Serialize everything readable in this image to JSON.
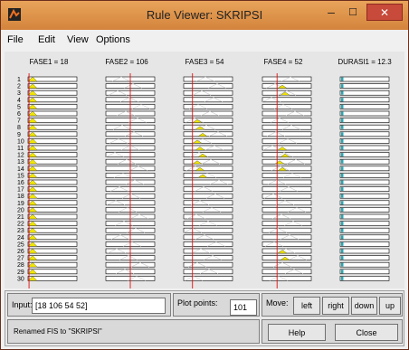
{
  "window": {
    "title": "Rule Viewer: SKRIPSI"
  },
  "menu": [
    "File",
    "Edit",
    "View",
    "Options"
  ],
  "columns": [
    {
      "label": "FASE1 = 18",
      "value_frac": 0.02
    },
    {
      "label": "FASE2 = 106",
      "value_frac": 0.5
    },
    {
      "label": "FASE3 = 54",
      "value_frac": 0.18
    },
    {
      "label": "FASE4 = 52",
      "value_frac": 0.3
    },
    {
      "label": "DURASI1 = 12.3",
      "value_frac": 0.0
    }
  ],
  "rules": [
    "1",
    "2",
    "3",
    "4",
    "5",
    "6",
    "7",
    "8",
    "9",
    "10",
    "11",
    "12",
    "13",
    "14",
    "15",
    "16",
    "17",
    "18",
    "19",
    "20",
    "21",
    "22",
    "23",
    "24",
    "25",
    "26",
    "27",
    "28",
    "29",
    "30"
  ],
  "input": {
    "label": "Input:",
    "value": "[18 106 54 52]"
  },
  "plot_points": {
    "label": "Plot points:",
    "value": "101"
  },
  "move": {
    "label": "Move:",
    "left": "left",
    "right": "right",
    "down": "down",
    "up": "up"
  },
  "status": "Renamed FIS to \"SKRIPSI\"",
  "buttons": {
    "help": "Help",
    "close": "Close"
  },
  "colors": {
    "fill": "#f2e600",
    "line": "#c8c8c8",
    "value_line": "#e01010",
    "output_fill": "#2aa6b2"
  }
}
